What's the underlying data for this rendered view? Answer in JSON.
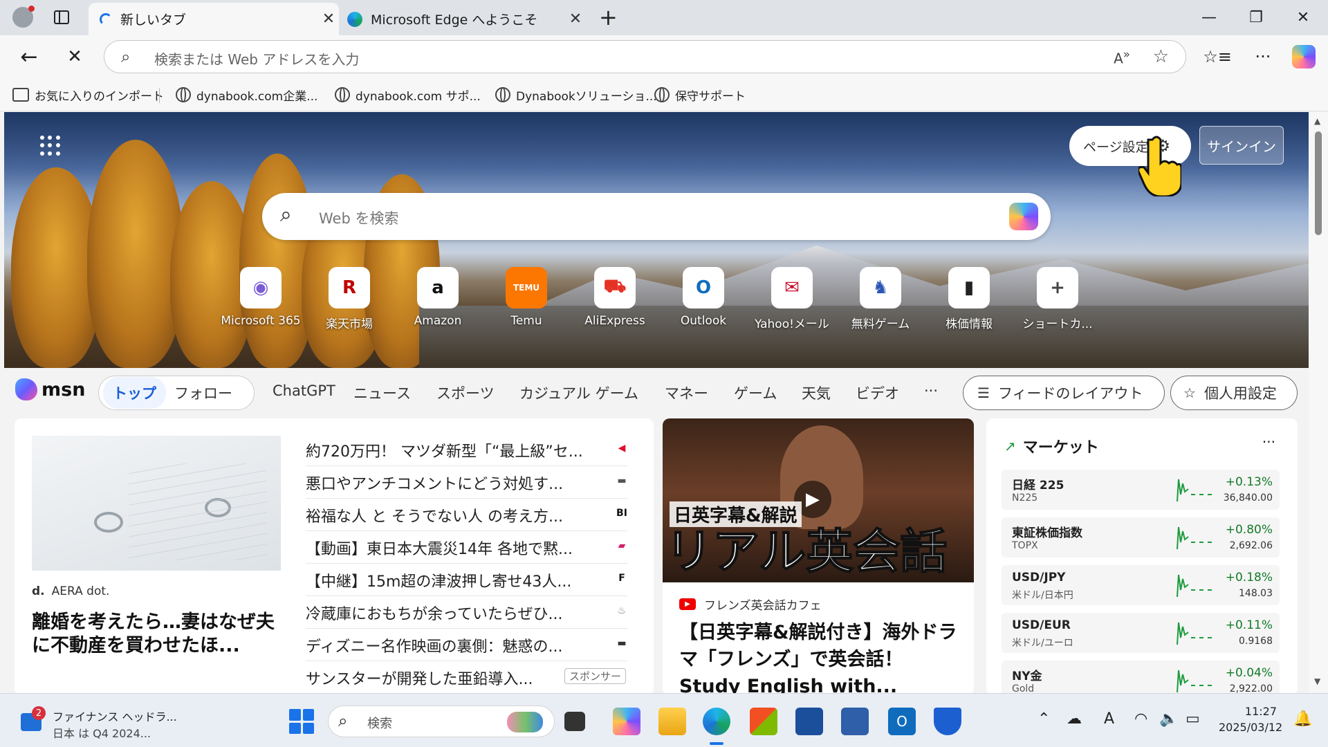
{
  "tabs": [
    {
      "title": "新しいタブ",
      "active": true
    },
    {
      "title": "Microsoft Edge へようこそ",
      "active": false
    }
  ],
  "omnibox": {
    "placeholder": "検索または Web アドレスを入力"
  },
  "favorites": [
    {
      "label": "お気に入りのインポート",
      "icon": "folder-import-icon"
    },
    {
      "label": "dynabook.com企業...",
      "icon": "globe-icon"
    },
    {
      "label": "dynabook.com サポ...",
      "icon": "globe-icon"
    },
    {
      "label": "Dynabookソリューショ...",
      "icon": "globe-icon"
    },
    {
      "label": "保守サポート",
      "icon": "globe-icon"
    }
  ],
  "hero": {
    "page_settings": "ページ設定",
    "signin": "サインイン",
    "search_placeholder": "Web を検索"
  },
  "shortcuts": [
    {
      "label": "Microsoft 365",
      "glyph": "◉",
      "color": "#7b5cd6"
    },
    {
      "label": "楽天市場",
      "glyph": "R",
      "color": "#bf0000"
    },
    {
      "label": "Amazon",
      "glyph": "a",
      "color": "#111111"
    },
    {
      "label": "Temu",
      "glyph": "TEMU",
      "color": "#fb7701"
    },
    {
      "label": "AliExpress",
      "glyph": "⛟",
      "color": "#e43225"
    },
    {
      "label": "Outlook",
      "glyph": "O",
      "color": "#0f6cbd"
    },
    {
      "label": "Yahoo!メール",
      "glyph": "✉",
      "color": "#c8102e"
    },
    {
      "label": "無料ゲーム",
      "glyph": "♞",
      "color": "#2b56b5"
    },
    {
      "label": "株価情報",
      "glyph": "▮",
      "color": "#222222"
    },
    {
      "label": "ショートカ...",
      "glyph": "+",
      "color": "#444444"
    }
  ],
  "msn": {
    "logo": "msn",
    "tab_top": "トップ",
    "tab_follow": "フォロー",
    "nav": [
      "ChatGPT",
      "ニュース",
      "スポーツ",
      "カジュアル ゲーム",
      "マネー",
      "ゲーム",
      "天気",
      "ビデオ",
      "···"
    ],
    "feed_layout": "フィードのレイアウト",
    "personalize": "個人用設定"
  },
  "main_card": {
    "source": "AERA dot.",
    "headline": "離婚を考えたら…妻はなぜ夫に不動産を買わせたほ..."
  },
  "headlines": [
    {
      "text": "約720万円！ マツダ新型「“最上級”セ...",
      "badge": "◀",
      "color": "#e0102a"
    },
    {
      "text": "悪口やアンチコメントにどう対処す...",
      "badge": "▬",
      "color": "#555555"
    },
    {
      "text": "裕福な人 と そうでない人 の考え方...",
      "badge": "BI",
      "color": "#111111"
    },
    {
      "text": "【動画】東日本大震災14年 各地で黙...",
      "badge": "▰",
      "color": "#d61f69"
    },
    {
      "text": "【中継】15m超の津波押し寄せ43人...",
      "badge": "F",
      "color": "#111111"
    },
    {
      "text": "冷蔵庫におもちが余っていたらぜひ...",
      "badge": "♨",
      "color": "#777777"
    },
    {
      "text": "ディズニー名作映画の裏側：魅惑の...",
      "badge": "▬",
      "color": "#333333"
    },
    {
      "text": "サンスターが開発した亜鉛導入...",
      "badge": "",
      "color": "#ffffff"
    }
  ],
  "sponsor_label": "スポンサー",
  "video_card": {
    "overlay_small": "日英字幕&解説",
    "overlay_big": "リアル英会話",
    "source": "フレンズ英会話カフェ",
    "title": "【日英字幕&解説付き】海外ドラマ「フレンズ」で英会話！Study English with..."
  },
  "market": {
    "title": "マーケット",
    "more": "···",
    "items": [
      {
        "name": "日経 225",
        "sub": "N225",
        "change": "+0.13%",
        "value": "36,840.00"
      },
      {
        "name": "東証株価指数",
        "sub": "TOPX",
        "change": "+0.80%",
        "value": "2,692.06"
      },
      {
        "name": "USD/JPY",
        "sub": "米ドル/日本円",
        "change": "+0.18%",
        "value": "148.03"
      },
      {
        "name": "USD/EUR",
        "sub": "米ドル/ユーロ",
        "change": "+0.11%",
        "value": "0.9168"
      },
      {
        "name": "NY金",
        "sub": "Gold",
        "change": "+0.04%",
        "value": "2,922.00"
      }
    ]
  },
  "taskbar": {
    "widget_title": "ファイナンス ヘッドラ...",
    "widget_sub": "日本 は Q4 2024...",
    "widget_badge": "2",
    "search_placeholder": "検索",
    "time": "11:27",
    "date": "2025/03/12"
  }
}
